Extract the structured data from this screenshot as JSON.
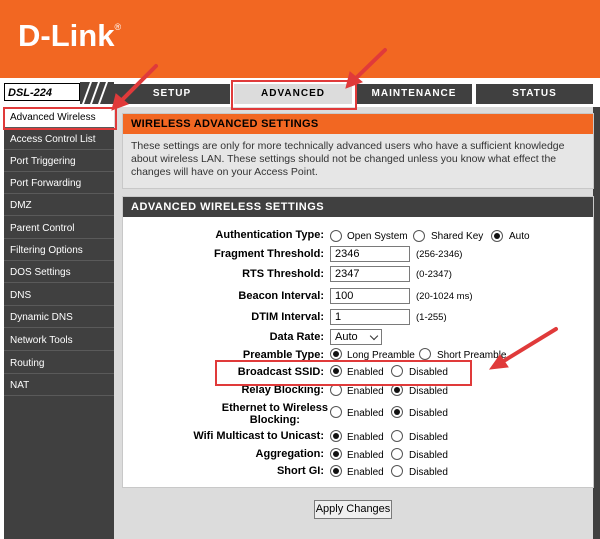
{
  "header": {
    "brand": "D-Link",
    "brand_mark": "®"
  },
  "model": "DSL-224",
  "tabs": [
    {
      "label": "SETUP"
    },
    {
      "label": "ADVANCED"
    },
    {
      "label": "MAINTENANCE"
    },
    {
      "label": "STATUS"
    }
  ],
  "sidebar": {
    "items": [
      {
        "label": "Advanced Wireless"
      },
      {
        "label": "Access Control List"
      },
      {
        "label": "Port Triggering"
      },
      {
        "label": "Port Forwarding"
      },
      {
        "label": "DMZ"
      },
      {
        "label": "Parent Control"
      },
      {
        "label": "Filtering Options"
      },
      {
        "label": "DOS Settings"
      },
      {
        "label": "DNS"
      },
      {
        "label": "Dynamic DNS"
      },
      {
        "label": "Network Tools"
      },
      {
        "label": "Routing"
      },
      {
        "label": "NAT"
      }
    ]
  },
  "info": {
    "title": "WIRELESS ADVANCED SETTINGS",
    "body": "These settings are only for more technically advanced users who have a sufficient knowledge about wireless LAN. These settings should not be changed unless you know what effect the changes will have on your Access Point."
  },
  "settings": {
    "title": "ADVANCED WIRELESS SETTINGS",
    "auth_type": {
      "label": "Authentication Type:",
      "options": [
        "Open System",
        "Shared Key",
        "Auto"
      ],
      "selected": "Auto"
    },
    "fragment": {
      "label": "Fragment Threshold:",
      "value": "2346",
      "hint": "(256-2346)"
    },
    "rts": {
      "label": "RTS Threshold:",
      "value": "2347",
      "hint": "(0-2347)"
    },
    "beacon": {
      "label": "Beacon Interval:",
      "value": "100",
      "hint": "(20-1024 ms)"
    },
    "dtim": {
      "label": "DTIM Interval:",
      "value": "1",
      "hint": "(1-255)"
    },
    "data_rate": {
      "label": "Data Rate:",
      "value": "Auto"
    },
    "preamble": {
      "label": "Preamble Type:",
      "options": [
        "Long Preamble",
        "Short Preamble"
      ],
      "selected": "Long Preamble"
    },
    "broadcast_ssid": {
      "label": "Broadcast SSID:",
      "options": [
        "Enabled",
        "Disabled"
      ],
      "selected": "Enabled"
    },
    "relay_blocking": {
      "label": "Relay Blocking:",
      "options": [
        "Enabled",
        "Disabled"
      ],
      "selected": "Disabled"
    },
    "eth_to_wireless": {
      "label_line1": "Ethernet to Wireless",
      "label_line2": "Blocking:",
      "options": [
        "Enabled",
        "Disabled"
      ],
      "selected": "Disabled"
    },
    "multicast": {
      "label": "Wifi Multicast to Unicast:",
      "options": [
        "Enabled",
        "Disabled"
      ],
      "selected": "Enabled"
    },
    "aggregation": {
      "label": "Aggregation:",
      "options": [
        "Enabled",
        "Disabled"
      ],
      "selected": "Enabled"
    },
    "short_gi": {
      "label": "Short GI:",
      "options": [
        "Enabled",
        "Disabled"
      ],
      "selected": "Enabled"
    }
  },
  "apply_label": "Apply Changes",
  "annotation_color": "#e03a3a"
}
